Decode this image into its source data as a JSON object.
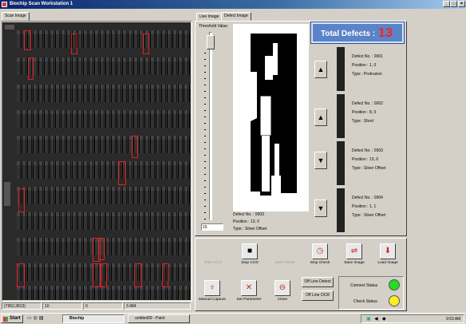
{
  "window": {
    "title": "Biochip Scan Workstation 1",
    "min": "_",
    "max": "□",
    "close": "×"
  },
  "left": {
    "tab": "Scan Image"
  },
  "statusbar": {
    "coords": "(7952,3813)",
    "c2": "10",
    "c3": "0",
    "c4": "3.484"
  },
  "right": {
    "tabs": [
      "Live Image",
      "Defect Image"
    ],
    "threshold_label": "Threshold Value",
    "threshold_value": "15",
    "total_defects_label": "Total Defects :",
    "total_defects_value": "13",
    "current_defect": {
      "no": "Defect No. : 0003",
      "pos": "Position : 13, 0",
      "type": "Type : Silver Offset"
    }
  },
  "defects": [
    {
      "no": "Defect No. : 0001",
      "pos": "Position : 1, 0",
      "type": "Type : Protrusion"
    },
    {
      "no": "Defect No. : 0002",
      "pos": "Position : 8, 0",
      "type": "Type : Short"
    },
    {
      "no": "Defect No. : 0003",
      "pos": "Position : 13, 0",
      "type": "Type : Silver Offset"
    },
    {
      "no": "Defect No. : 0004",
      "pos": "Position : 1, 1",
      "type": "Type : Silver Offset"
    }
  ],
  "nav_buttons": [
    "▲",
    "▲",
    "▼",
    "▼"
  ],
  "buttons": {
    "start_ccd": "Start CCD",
    "stop_ccd": "Stop CCD",
    "start_check": "Start Check",
    "stop_check": "Stop Check",
    "save_image": "Save Image",
    "load_image": "Load Image",
    "manual_capture": "Manual Capture",
    "set_parameter": "Set Parameter",
    "close": "Close",
    "offline_detect": "Off Line Detect",
    "offline_ocr": "Off Line OCR"
  },
  "status": {
    "connect": "Connect Status",
    "check": "Check Status",
    "connect_color": "#22dd22",
    "check_color": "#ffee22"
  },
  "taskbar": {
    "start": "Start",
    "items": [
      "Biochip",
      "untitled09 - Paint"
    ],
    "time": "9:53 AM"
  }
}
